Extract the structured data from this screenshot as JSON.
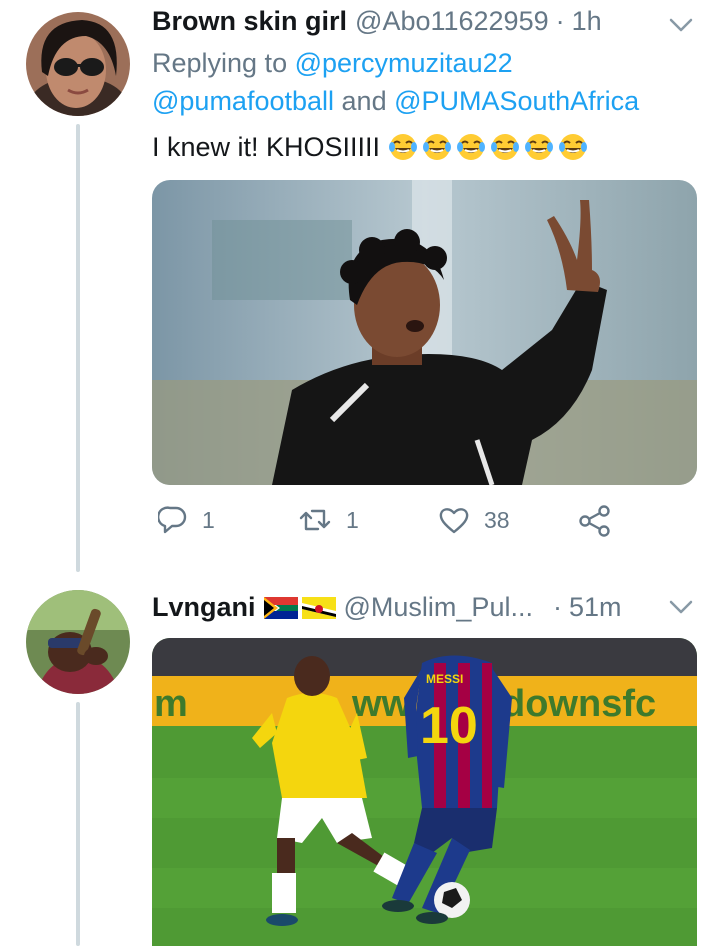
{
  "tweets": [
    {
      "name": "Brown skin girl",
      "handle": "@Abo11622959",
      "separator": "·",
      "time": "1h",
      "replying_prefix": "Replying to",
      "reply_mentions_line1": "@percymuzitau22",
      "reply_mentions_line2a": "@pumafootball",
      "reply_and": "and",
      "reply_mentions_line2b": "@PUMASouthAfrica",
      "text": "I knew it! KHOSIIIII",
      "emoji": [
        "tears-of-joy",
        "tears-of-joy",
        "tears-of-joy",
        "tears-of-joy",
        "tears-of-joy",
        "tears-of-joy"
      ],
      "counts": {
        "replies": "1",
        "retweets": "1",
        "likes": "38"
      }
    },
    {
      "name": "Lvngani",
      "handle": "@Muslim_Pul...",
      "separator": "·",
      "time": "51m",
      "flags": [
        "south-africa-flag",
        "brunei-flag"
      ],
      "banner_text": "downsfc",
      "banner_left": "m",
      "banner_mid": "ww",
      "jersey_name": "MESSI",
      "jersey_number": "10"
    }
  ],
  "colors": {
    "link": "#1da1f2",
    "meta": "#657786",
    "thread_line": "#cfd9de"
  }
}
